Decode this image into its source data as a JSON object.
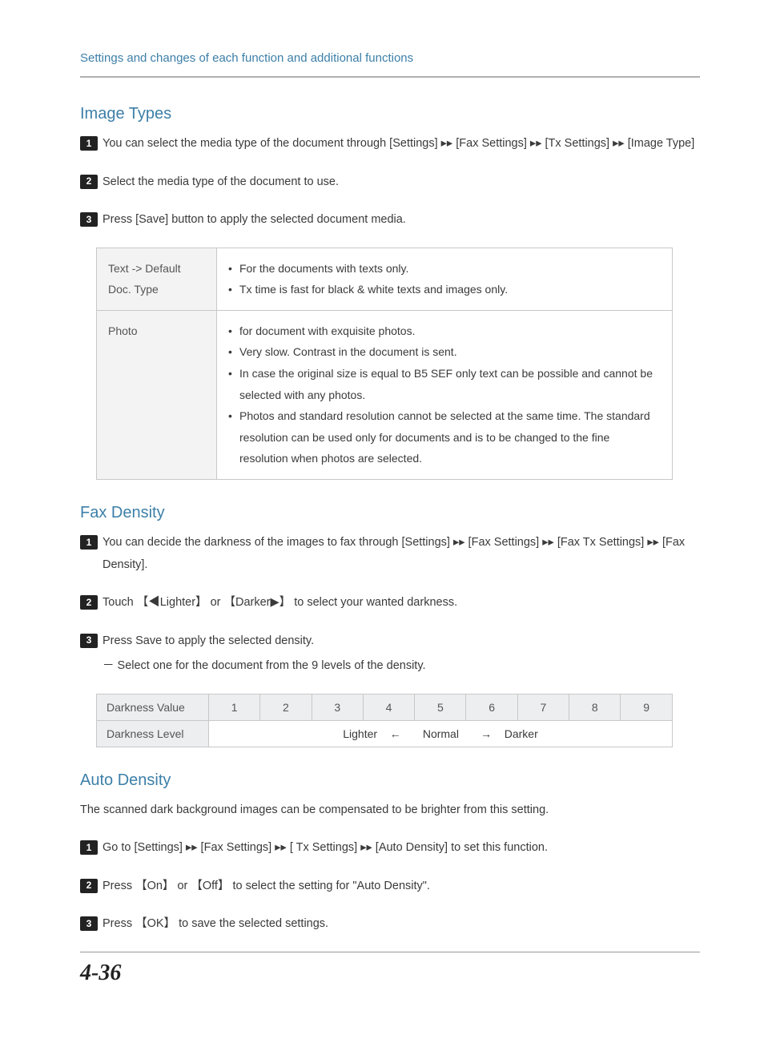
{
  "header": {
    "title": "Settings and changes of each function and additional functions"
  },
  "section_image_types": {
    "title": "Image Types",
    "steps": [
      "You can select the media type of the document through [Settings] ▸▸ [Fax Settings] ▸▸ [Tx Settings] ▸▸ [Image Type]",
      "Select the media type of the document to use.",
      "Press [Save] button to apply the selected document media."
    ],
    "table": {
      "rows": [
        {
          "label": "Text -> Default Doc. Type",
          "items": [
            "For the documents with texts only.",
            "Tx time is fast for black & white texts and images only."
          ]
        },
        {
          "label": "Photo",
          "items": [
            "for document with exquisite photos.",
            "Very slow. Contrast in the document is sent.",
            "In case the original size is equal to B5 SEF only text can be possible and cannot be selected with any photos.",
            "Photos and standard resolution cannot be selected at the  same time. The standard resolution can be used only for documents and is to be changed to the fine resolution when photos are selected."
          ]
        }
      ]
    }
  },
  "section_fax_density": {
    "title": "Fax Density",
    "steps": [
      "You can decide the darkness of the images to fax through [Settings] ▸▸ [Fax Settings] ▸▸ [Fax Tx Settings] ▸▸ [Fax Density].",
      "Touch 【◀Lighter】 or 【Darker▶】 to select your wanted darkness.",
      "Press Save to apply the selected density."
    ],
    "sub_note": "－ Select one for the document from the 9 levels of the density.",
    "table": {
      "head_label": "Darkness Value",
      "cols": [
        "1",
        "2",
        "3",
        "4",
        "5",
        "6",
        "7",
        "8",
        "9"
      ],
      "row_label": "Darkness Level",
      "row_value": "Lighter    ←       Normal       →    Darker"
    }
  },
  "section_auto_density": {
    "title": "Auto Density",
    "intro": "The scanned dark background images can be compensated to be brighter from this setting.",
    "steps": [
      "Go to [Settings] ▸▸ [Fax Settings] ▸▸ [ Tx Settings] ▸▸ [Auto Density] to set this function.",
      "Press 【On】 or 【Off】 to select the setting for \"Auto Density\".",
      "Press 【OK】 to save the selected settings."
    ]
  },
  "footer": {
    "page_number": "4-36"
  }
}
